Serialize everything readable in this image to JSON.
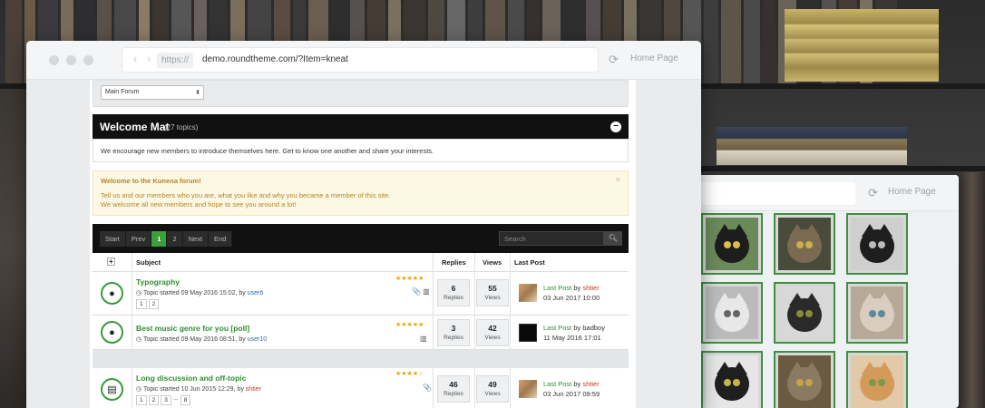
{
  "browser": {
    "url_protocol": "https://",
    "url": "demo.roundtheme.com/?Item=kneat",
    "home_link": "Home Page"
  },
  "back_browser": {
    "home_link": "Home Page",
    "cats": [
      {
        "face": "#1d1d1d",
        "bg": "#6a8a5a",
        "eye": "#d8c04a"
      },
      {
        "face": "#7a6a52",
        "bg": "#4a4a3a",
        "eye": "#c8b050"
      },
      {
        "face": "#1e1e1e",
        "bg": "#cfcfcf",
        "eye": "#bbbbbb"
      },
      {
        "face": "#e8e8e8",
        "bg": "#bbbbbb",
        "eye": "#666666"
      },
      {
        "face": "#2a2a2a",
        "bg": "#d8d8d8",
        "eye": "#8a8a3a"
      },
      {
        "face": "#d9cdbf",
        "bg": "#b7a898",
        "eye": "#5a8aa0"
      },
      {
        "face": "#1f1f1f",
        "bg": "#e6e6e6",
        "eye": "#c8b64a"
      },
      {
        "face": "#8a7a62",
        "bg": "#6a5a42",
        "eye": "#c8a24a"
      },
      {
        "face": "#d49a5a",
        "bg": "#e2c9a8",
        "eye": "#7a9a4a"
      }
    ]
  },
  "forum": {
    "select_value": "Main Forum",
    "category": {
      "title": "Welcome Mat",
      "count": "(27 topics)",
      "description": "We encourage new members to introduce themselves here. Get to know one another and share your interests."
    },
    "notice": {
      "title": "Welcome to the Kunena forum!",
      "line1": "Tell us and our members who you are, what you like and why you became a member of this site.",
      "line2": "We welcome all new members and hope to see you around a lot!",
      "close": "×"
    },
    "pager": [
      "Start",
      "Prev",
      "1",
      "2",
      "Next",
      "End"
    ],
    "search_placeholder": "Search",
    "headers": {
      "plus": "+",
      "subject": "Subject",
      "replies": "Replies",
      "views": "Views",
      "last_post": "Last Post"
    },
    "topics": [
      {
        "title": "Typography",
        "started": "Topic started 09 May 2016 15:02, by ",
        "author": "user6",
        "pages": [
          "1",
          "2"
        ],
        "stars": "★★★★★",
        "icons": "📎 ▥",
        "replies": "6",
        "views": "55",
        "replies_label": "Replies",
        "views_label": "Views",
        "last_post_link": "Last Post",
        "last_by": " by ",
        "last_user": "shtier",
        "last_date": "03 Jun 2017 10:00"
      },
      {
        "title": "Best music genre for you [poll]",
        "started": "Topic started 09 May 2016 08:51, by ",
        "author": "user10",
        "pages": [],
        "stars": "★★★★★",
        "icons": "▥",
        "replies": "3",
        "views": "42",
        "replies_label": "Replies",
        "views_label": "Views",
        "last_post_link": "Last Post",
        "last_by": " by badboy",
        "last_user": "",
        "last_date": "11 May 2016 17:01"
      },
      {
        "title": "Long discussion and off-topic",
        "started": "Topic started 10 Jun 2015 12:29, by ",
        "author": "shtier",
        "pages": [
          "1",
          "2",
          "3",
          "...",
          "8"
        ],
        "stars": "★★★★☆",
        "icons": "📎",
        "replies": "46",
        "views": "49",
        "replies_label": "Replies",
        "views_label": "Views",
        "last_post_link": "Last Post",
        "last_by": " by ",
        "last_user": "shtier",
        "last_date": "03 Jun 2017 09:59"
      }
    ]
  }
}
